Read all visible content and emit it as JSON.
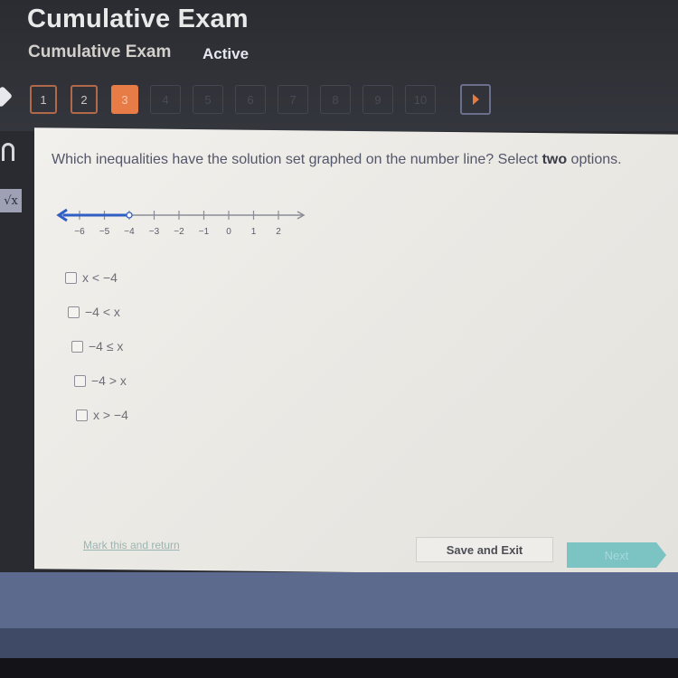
{
  "header": {
    "title": "Cumulative Exam",
    "subtitle": "Cumulative Exam",
    "status": "Active"
  },
  "question_nav": {
    "buttons": [
      {
        "label": "1",
        "state": "answered"
      },
      {
        "label": "2",
        "state": "answered"
      },
      {
        "label": "3",
        "state": "current"
      },
      {
        "label": "4",
        "state": "locked"
      },
      {
        "label": "5",
        "state": "locked"
      },
      {
        "label": "6",
        "state": "locked"
      },
      {
        "label": "7",
        "state": "locked"
      },
      {
        "label": "8",
        "state": "locked"
      },
      {
        "label": "9",
        "state": "locked"
      },
      {
        "label": "10",
        "state": "locked"
      }
    ],
    "next_icon": "play-arrow-icon",
    "accent_color": "#e87c46"
  },
  "sidebar": {
    "icons": [
      "headphones-icon",
      "square-root-icon"
    ]
  },
  "question": {
    "prompt_before": "Which inequalities have the solution set graphed on the number line? Select ",
    "prompt_bold": "two",
    "prompt_after": " options.",
    "number_line": {
      "ticks": [
        "-6",
        "-5",
        "-4",
        "-3",
        "-2",
        "-1",
        "0",
        "1",
        "2"
      ],
      "open_point": -4,
      "shaded_direction": "left",
      "shade_color": "#2f5fc4"
    },
    "options": [
      {
        "label": "x < −4",
        "checked": false
      },
      {
        "label": "−4 < x",
        "checked": false
      },
      {
        "label": "−4 ≤ x",
        "checked": false
      },
      {
        "label": "−4 > x",
        "checked": false
      },
      {
        "label": "x > −4",
        "checked": false
      }
    ]
  },
  "footer": {
    "mark_link": "Mark this and return",
    "save_label": "Save and Exit",
    "next_label": "Next",
    "next_color": "#7cc3c4"
  }
}
